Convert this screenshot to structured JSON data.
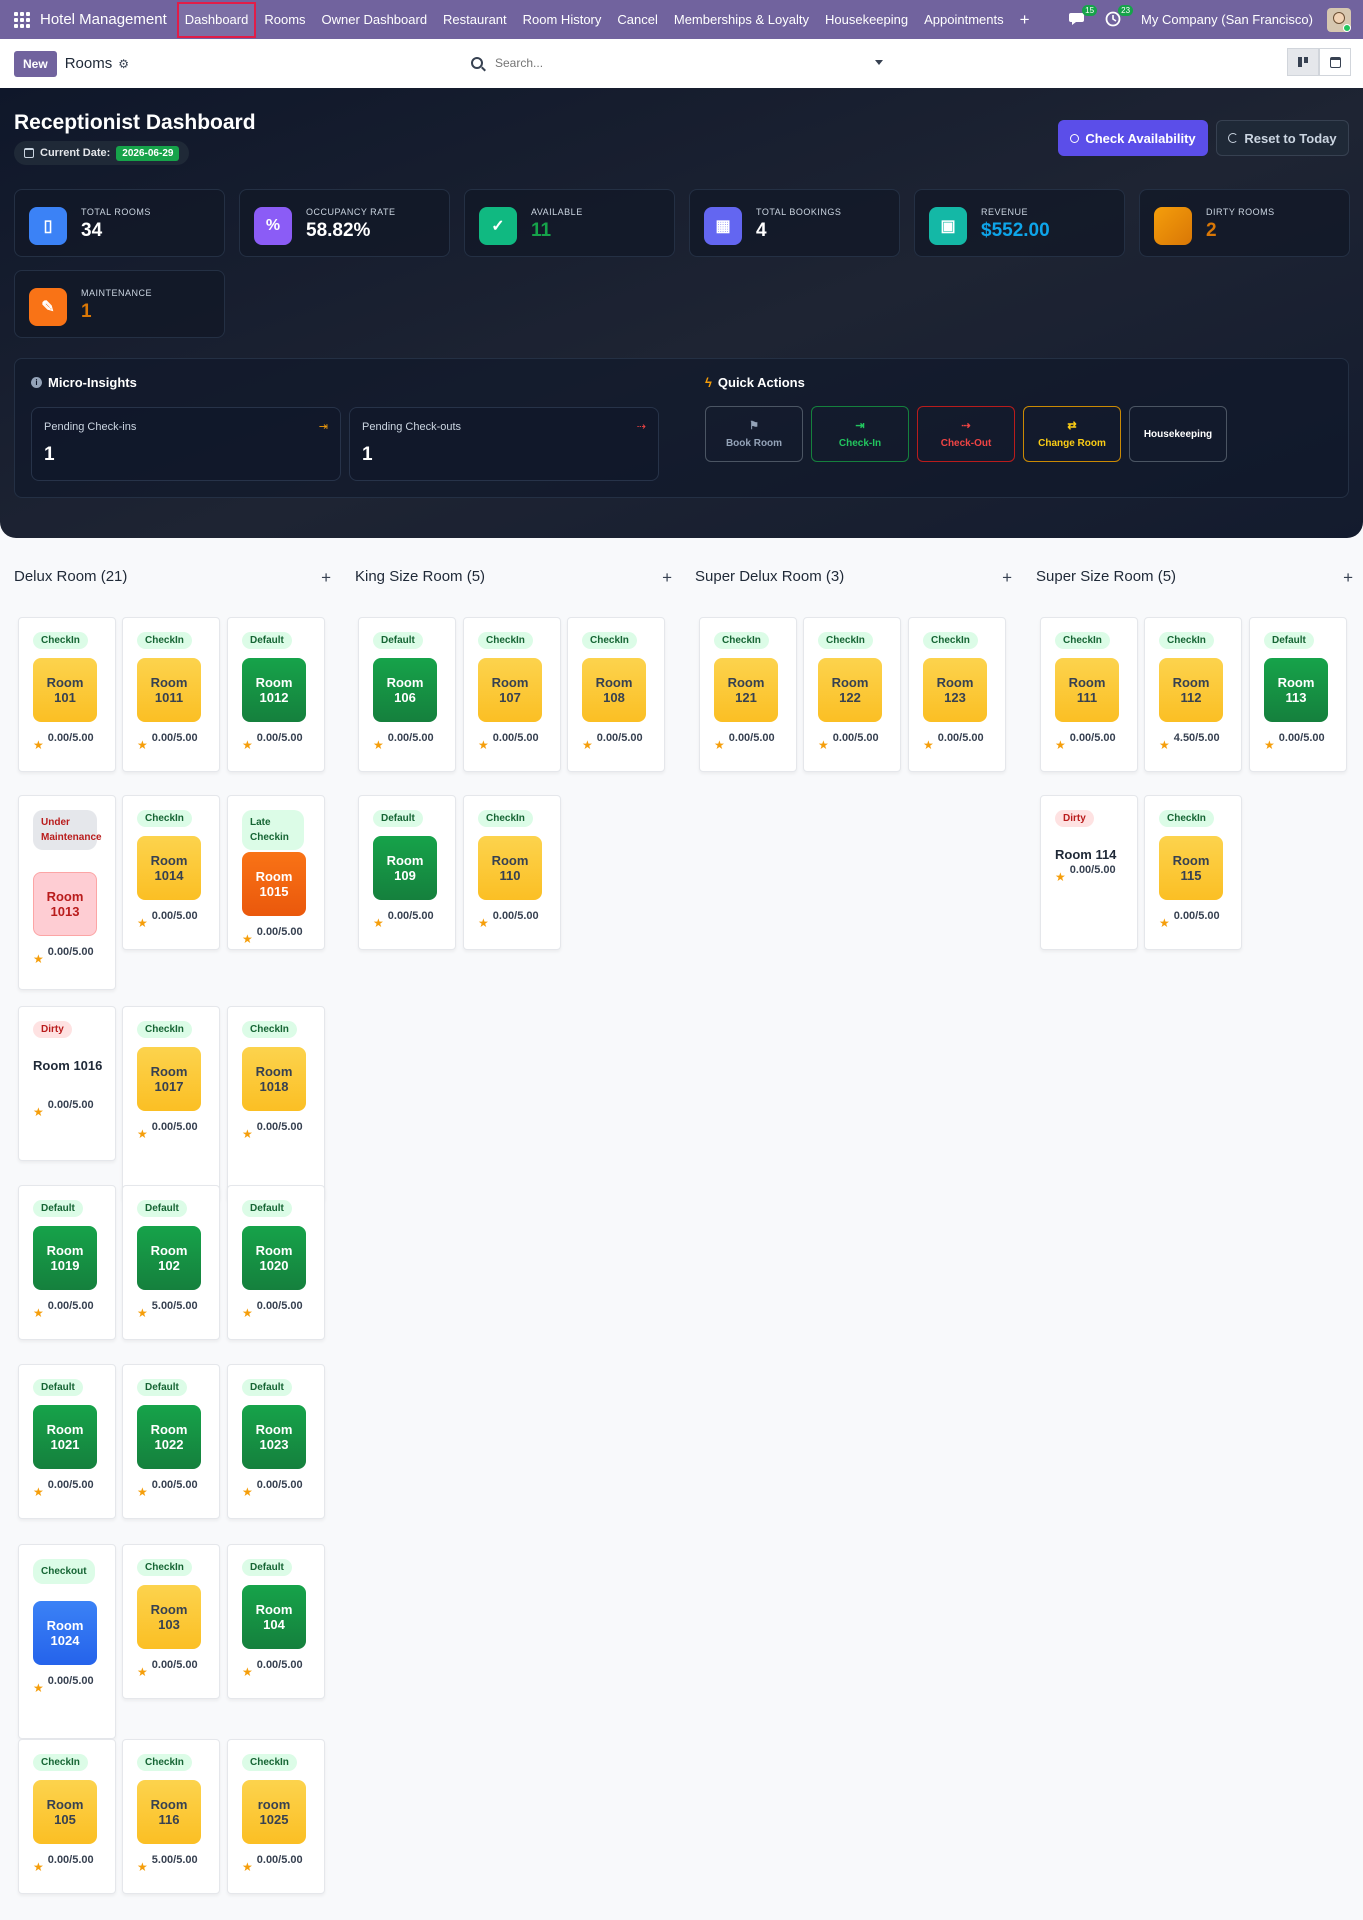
{
  "nav": {
    "brand": "Hotel Management",
    "items": [
      "Dashboard",
      "Rooms",
      "Owner Dashboard",
      "Restaurant",
      "Room History",
      "Cancel",
      "Memberships & Loyalty",
      "Housekeeping",
      "Appointments"
    ],
    "messages_count": "15",
    "activities_count": "23",
    "company": "My Company (San Francisco)"
  },
  "control": {
    "new_label": "New",
    "breadcrumb": "Rooms",
    "search_placeholder": "Search..."
  },
  "dashboard": {
    "title": "Receptionist Dashboard",
    "date_label": "Current Date:",
    "date_value": "2026-06-29",
    "check_availability": "Check Availability",
    "reset_today": "Reset to Today",
    "stats": [
      {
        "label": "TOTAL ROOMS",
        "value": "34",
        "icon": "building-icon",
        "color": "#3b82f6"
      },
      {
        "label": "OCCUPANCY RATE",
        "value": "58.82%",
        "icon": "percent-icon",
        "color": "#8b5cf6"
      },
      {
        "label": "AVAILABLE",
        "value": "11",
        "icon": "check-circle-icon",
        "color": "#10b981"
      },
      {
        "label": "TOTAL BOOKINGS",
        "value": "4",
        "icon": "calendar-check-icon",
        "color": "#6366f1"
      },
      {
        "label": "REVENUE",
        "value": "$552.00",
        "icon": "money-icon",
        "color": "#14b8a6"
      },
      {
        "label": "DIRTY ROOMS",
        "value": "2",
        "icon": "dirty-icon",
        "color": "#f59e0b"
      },
      {
        "label": "MAINTENANCE",
        "value": "1",
        "icon": "wrench-icon",
        "color": "#f97316"
      }
    ],
    "insights_title": "Micro-Insights",
    "insights": [
      {
        "label": "Pending Check-ins",
        "value": "1"
      },
      {
        "label": "Pending Check-outs",
        "value": "1"
      }
    ],
    "quick_title": "Quick Actions",
    "quick_actions": [
      "Book Room",
      "Check-In",
      "Check-Out",
      "Change Room",
      "Housekeeping"
    ]
  },
  "columns": [
    {
      "title": "Delux Room (21)"
    },
    {
      "title": "King Size Room (5)"
    },
    {
      "title": "Super Delux Room (3)"
    },
    {
      "title": "Super Size Room (5)"
    }
  ],
  "cards": [
    {
      "status": "CheckIn",
      "room": "Room 101",
      "rating": "0.00/5.00"
    },
    {
      "status": "CheckIn",
      "room": "Room 1011",
      "rating": "0.00/5.00"
    },
    {
      "status": "Default",
      "room": "Room 1012",
      "rating": "0.00/5.00"
    },
    {
      "status": "Under Maintenance",
      "room": "Room 1013",
      "rating": "0.00/5.00"
    },
    {
      "status": "CheckIn",
      "room": "Room 1014",
      "rating": "0.00/5.00"
    },
    {
      "status": "Late Checkin",
      "room": "Room 1015",
      "rating": "0.00/5.00"
    },
    {
      "status": "Dirty",
      "room": "Room 1016",
      "rating": "0.00/5.00"
    },
    {
      "status": "CheckIn",
      "room": "Room 1017",
      "rating": "0.00/5.00"
    },
    {
      "status": "CheckIn",
      "room": "Room 1018",
      "rating": "0.00/5.00"
    },
    {
      "status": "Default",
      "room": "Room 1019",
      "rating": "0.00/5.00"
    },
    {
      "status": "Default",
      "room": "Room 102",
      "rating": "5.00/5.00"
    },
    {
      "status": "Default",
      "room": "Room 1020",
      "rating": "0.00/5.00"
    },
    {
      "status": "Default",
      "room": "Room 1021",
      "rating": "0.00/5.00"
    },
    {
      "status": "Default",
      "room": "Room 1022",
      "rating": "0.00/5.00"
    },
    {
      "status": "Default",
      "room": "Room 1023",
      "rating": "0.00/5.00"
    },
    {
      "status": "Checkout",
      "room": "Room 1024",
      "rating": "0.00/5.00"
    },
    {
      "status": "CheckIn",
      "room": "Room 103",
      "rating": "0.00/5.00"
    },
    {
      "status": "Default",
      "room": "Room 104",
      "rating": "0.00/5.00"
    },
    {
      "status": "CheckIn",
      "room": "Room 105",
      "rating": "0.00/5.00"
    },
    {
      "status": "CheckIn",
      "room": "Room 116",
      "rating": "5.00/5.00"
    },
    {
      "status": "CheckIn",
      "room": "room 1025",
      "rating": "0.00/5.00"
    },
    {
      "status": "Default",
      "room": "Room 106",
      "rating": "0.00/5.00"
    },
    {
      "status": "CheckIn",
      "room": "Room 107",
      "rating": "0.00/5.00"
    },
    {
      "status": "CheckIn",
      "room": "Room 108",
      "rating": "0.00/5.00"
    },
    {
      "status": "Default",
      "room": "Room 109",
      "rating": "0.00/5.00"
    },
    {
      "status": "CheckIn",
      "room": "Room 110",
      "rating": "0.00/5.00"
    },
    {
      "status": "CheckIn",
      "room": "Room 121",
      "rating": "0.00/5.00"
    },
    {
      "status": "CheckIn",
      "room": "Room 122",
      "rating": "0.00/5.00"
    },
    {
      "status": "CheckIn",
      "room": "Room 123",
      "rating": "0.00/5.00"
    },
    {
      "status": "CheckIn",
      "room": "Room 111",
      "rating": "0.00/5.00"
    },
    {
      "status": "CheckIn",
      "room": "Room 112",
      "rating": "4.50/5.00"
    },
    {
      "status": "Default",
      "room": "Room 113",
      "rating": "0.00/5.00"
    },
    {
      "status": "Dirty",
      "room": "Room 114",
      "rating": "0.00/5.00"
    },
    {
      "status": "CheckIn",
      "room": "Room 115",
      "rating": "0.00/5.00"
    }
  ]
}
